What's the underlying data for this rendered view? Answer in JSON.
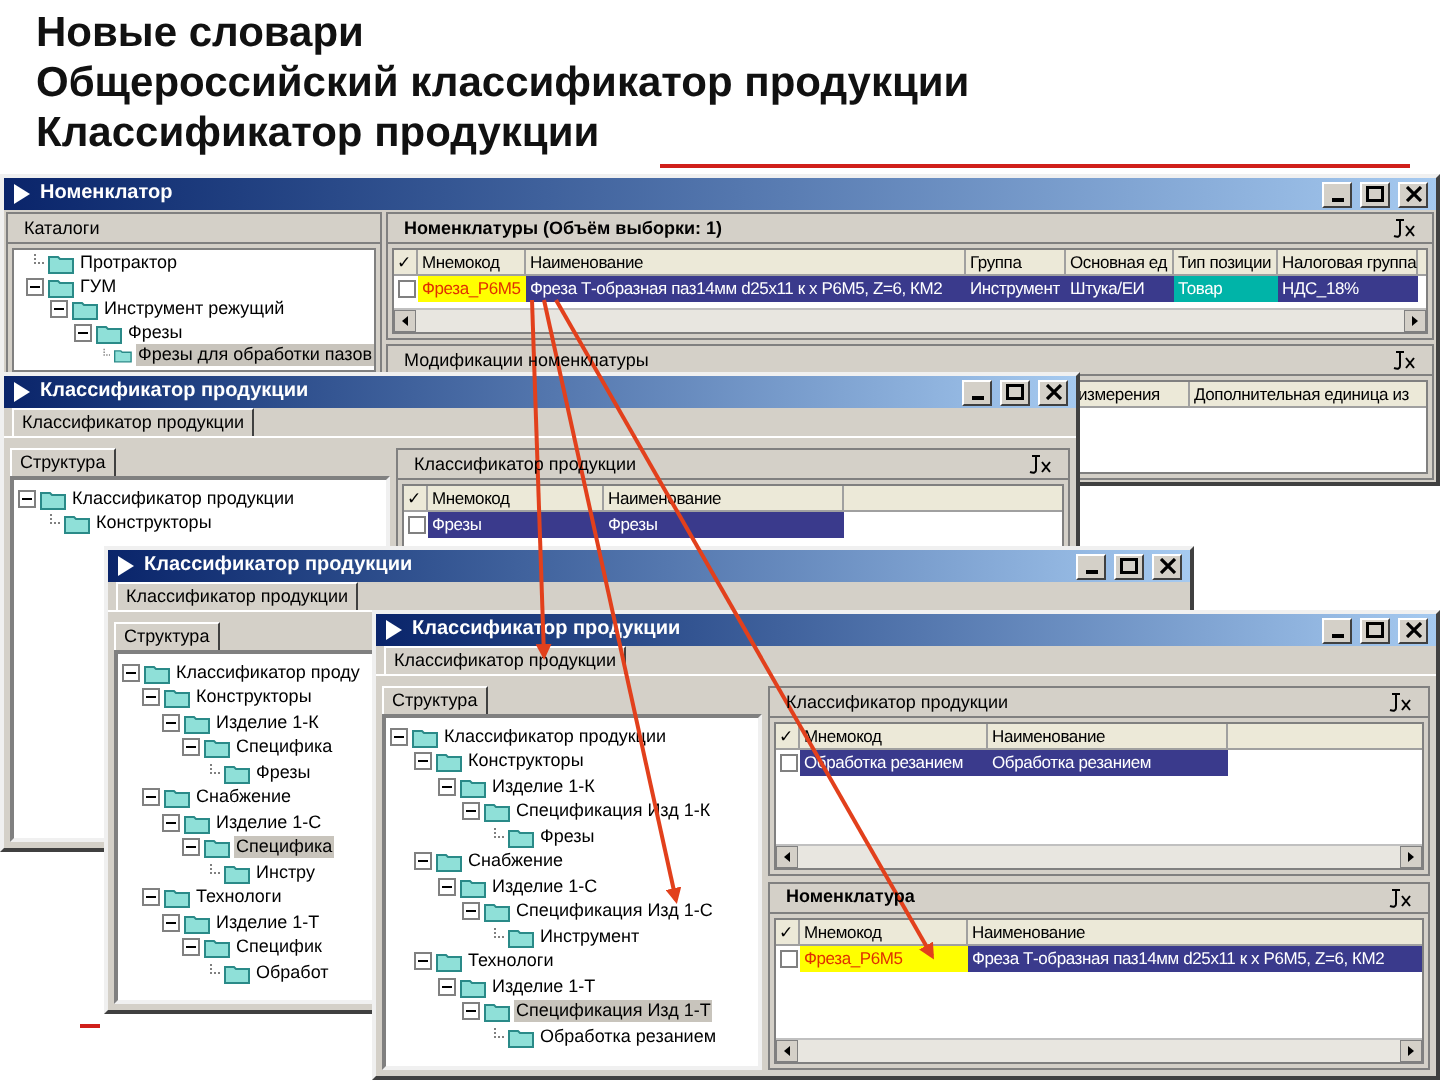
{
  "slide_title": [
    "Новые словари",
    "Общероссийский классификатор продукции",
    "Классификатор продукции"
  ],
  "windows": [
    {
      "kind": "nomenclator",
      "title": "Номенклатор",
      "catalogs_label": "Каталоги",
      "tree": [
        {
          "label": "Протрактор",
          "selected": false
        },
        {
          "label": "ГУМ",
          "selected": false,
          "children": [
            {
              "label": "Инструмент режущий",
              "selected": false,
              "children": [
                {
                  "label": "Фрезы",
                  "selected": false,
                  "children": [
                    {
                      "label": "Фрезы для обработки пазов",
                      "selected": true
                    }
                  ]
                }
              ]
            }
          ]
        }
      ],
      "panels": [
        {
          "title": "Номенклатуры (Объём выборки: 1)",
          "active": true,
          "check_header": "✓",
          "columns": [
            "Мнемокод",
            "Наименование",
            "Группа",
            "Основная ед",
            "Тип позиции",
            "Налоговая группа"
          ],
          "rows": [
            {
              "checked": false,
              "selected": true,
              "cells": [
                {
                  "text": "Фреза_Р6М5",
                  "color": "#ffff00"
                },
                {
                  "text": "Фреза Т-образная паз14мм d25x11 к х Р6М5, Z=6, КМ2"
                },
                {
                  "text": "Инструмент"
                },
                {
                  "text": "Штука/ЕИ"
                },
                {
                  "text": "Товар",
                  "color": "#00b4a8"
                },
                {
                  "text": "НДС_18%"
                }
              ]
            }
          ]
        },
        {
          "title": "Модификации номенклатуры",
          "active": false,
          "columns": [
            "измерения",
            "Дополнительная единица из"
          ]
        }
      ]
    },
    {
      "kind": "classifier",
      "title": "Классификатор продукции",
      "tab": "Классификатор продукции",
      "structure_tab": "Структура",
      "tree": [
        {
          "label": "Классификатор продукции",
          "selected": false,
          "children": [
            {
              "label": "Конструкторы",
              "selected": false
            }
          ]
        }
      ],
      "panels": [
        {
          "title": "Классификатор продукции",
          "active": false,
          "check_header": "✓",
          "columns": [
            "Мнемокод",
            "Наименование"
          ],
          "rows": [
            {
              "checked": false,
              "selected": true,
              "cells": [
                {
                  "text": "Фрезы"
                },
                {
                  "text": "Фрезы"
                }
              ]
            }
          ]
        }
      ]
    },
    {
      "kind": "classifier",
      "title": "Классификатор продукции",
      "tab": "Классификатор продукции",
      "structure_tab": "Структура",
      "tree": [
        {
          "label": "Классификатор проду",
          "selected": false,
          "children": [
            {
              "label": "Конструкторы",
              "selected": false,
              "children": [
                {
                  "label": "Изделие 1-К",
                  "selected": false,
                  "children": [
                    {
                      "label": "Специфика",
                      "selected": false,
                      "children": [
                        {
                          "label": "Фрезы",
                          "selected": false
                        }
                      ]
                    }
                  ]
                }
              ]
            },
            {
              "label": "Снабжение",
              "selected": false,
              "children": [
                {
                  "label": "Изделие 1-С",
                  "selected": false,
                  "children": [
                    {
                      "label": "Специфика",
                      "selected": true,
                      "children": [
                        {
                          "label": "Инстру",
                          "selected": false
                        }
                      ]
                    }
                  ]
                }
              ]
            },
            {
              "label": "Технологи",
              "selected": false,
              "children": [
                {
                  "label": "Изделие 1-Т",
                  "selected": false,
                  "children": [
                    {
                      "label": "Специфик",
                      "selected": false,
                      "children": [
                        {
                          "label": "Обработ",
                          "selected": false
                        }
                      ]
                    }
                  ]
                }
              ]
            }
          ]
        }
      ]
    },
    {
      "kind": "classifier",
      "title": "Классификатор продукции",
      "tab": "Классификатор продукции",
      "structure_tab": "Структура",
      "tree": [
        {
          "label": "Классификатор продукции",
          "selected": false,
          "children": [
            {
              "label": "Конструкторы",
              "selected": false,
              "children": [
                {
                  "label": "Изделие 1-К",
                  "selected": false,
                  "children": [
                    {
                      "label": "Спецификация Изд 1-К",
                      "selected": false,
                      "children": [
                        {
                          "label": "Фрезы",
                          "selected": false
                        }
                      ]
                    }
                  ]
                }
              ]
            },
            {
              "label": "Снабжение",
              "selected": false,
              "children": [
                {
                  "label": "Изделие 1-С",
                  "selected": false,
                  "children": [
                    {
                      "label": "Спецификация Изд 1-С",
                      "selected": false,
                      "children": [
                        {
                          "label": "Инструмент",
                          "selected": false
                        }
                      ]
                    }
                  ]
                }
              ]
            },
            {
              "label": "Технологи",
              "selected": false,
              "children": [
                {
                  "label": "Изделие 1-Т",
                  "selected": false,
                  "children": [
                    {
                      "label": "Спецификация Изд 1-Т",
                      "selected": true,
                      "children": [
                        {
                          "label": "Обработка резанием",
                          "selected": false
                        }
                      ]
                    }
                  ]
                }
              ]
            }
          ]
        }
      ],
      "panels": [
        {
          "title": "Классификатор продукции",
          "active": false,
          "check_header": "✓",
          "columns": [
            "Мнемокод",
            "Наименование"
          ],
          "rows": [
            {
              "checked": false,
              "selected": true,
              "cells": [
                {
                  "text": "Обработка резанием"
                },
                {
                  "text": "Обработка резанием"
                }
              ]
            }
          ]
        },
        {
          "title": "Номенклатура",
          "active": true,
          "check_header": "✓",
          "columns": [
            "Мнемокод",
            "Наименование"
          ],
          "rows": [
            {
              "checked": false,
              "selected": true,
              "cells": [
                {
                  "text": "Фреза_Р6М5",
                  "color": "#ffff00"
                },
                {
                  "text": "Фреза Т-образная паз14мм d25x11 к х Р6М5, Z=6, КМ2"
                }
              ]
            }
          ]
        }
      ]
    }
  ]
}
